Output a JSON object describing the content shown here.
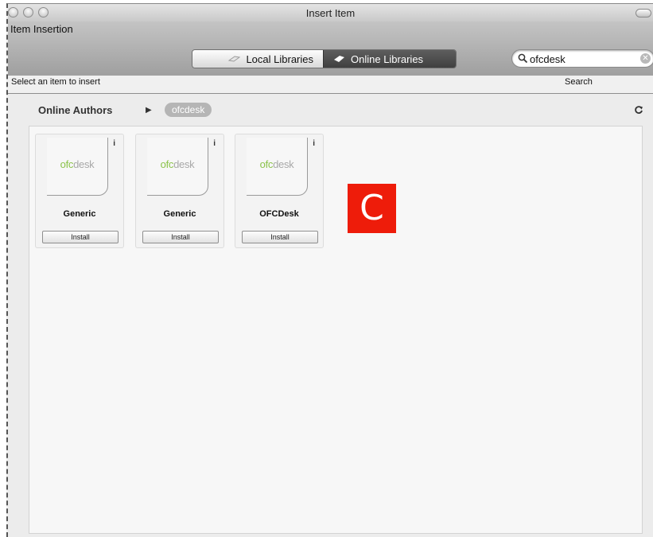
{
  "window": {
    "title": "Insert Item"
  },
  "toolbar": {
    "title": "Item Insertion",
    "segments": {
      "local": "Local Libraries",
      "online": "Online Libraries"
    },
    "hint": "Select an item to insert",
    "search_label": "Search"
  },
  "search": {
    "value": "ofcdesk"
  },
  "path": {
    "root": "Online Authors",
    "current": "ofcdesk"
  },
  "items": [
    {
      "logo_green": "ofc",
      "logo_gray": "desk",
      "name": "Generic",
      "action": "Install",
      "info": "i"
    },
    {
      "logo_green": "ofc",
      "logo_gray": "desk",
      "name": "Generic",
      "action": "Install",
      "info": "i"
    },
    {
      "logo_green": "ofc",
      "logo_gray": "desk",
      "name": "OFCDesk",
      "action": "Install",
      "info": "i"
    }
  ],
  "overlay": {
    "marker_letter": "C",
    "marker_color": "#ee1c0a"
  },
  "colors": {
    "brand_green": "#8bc34a",
    "brand_gray": "#a8a8a8"
  },
  "icons": [
    "search-icon",
    "clear-icon",
    "library-icon",
    "cloud-icon",
    "refresh-icon",
    "info-icon"
  ]
}
